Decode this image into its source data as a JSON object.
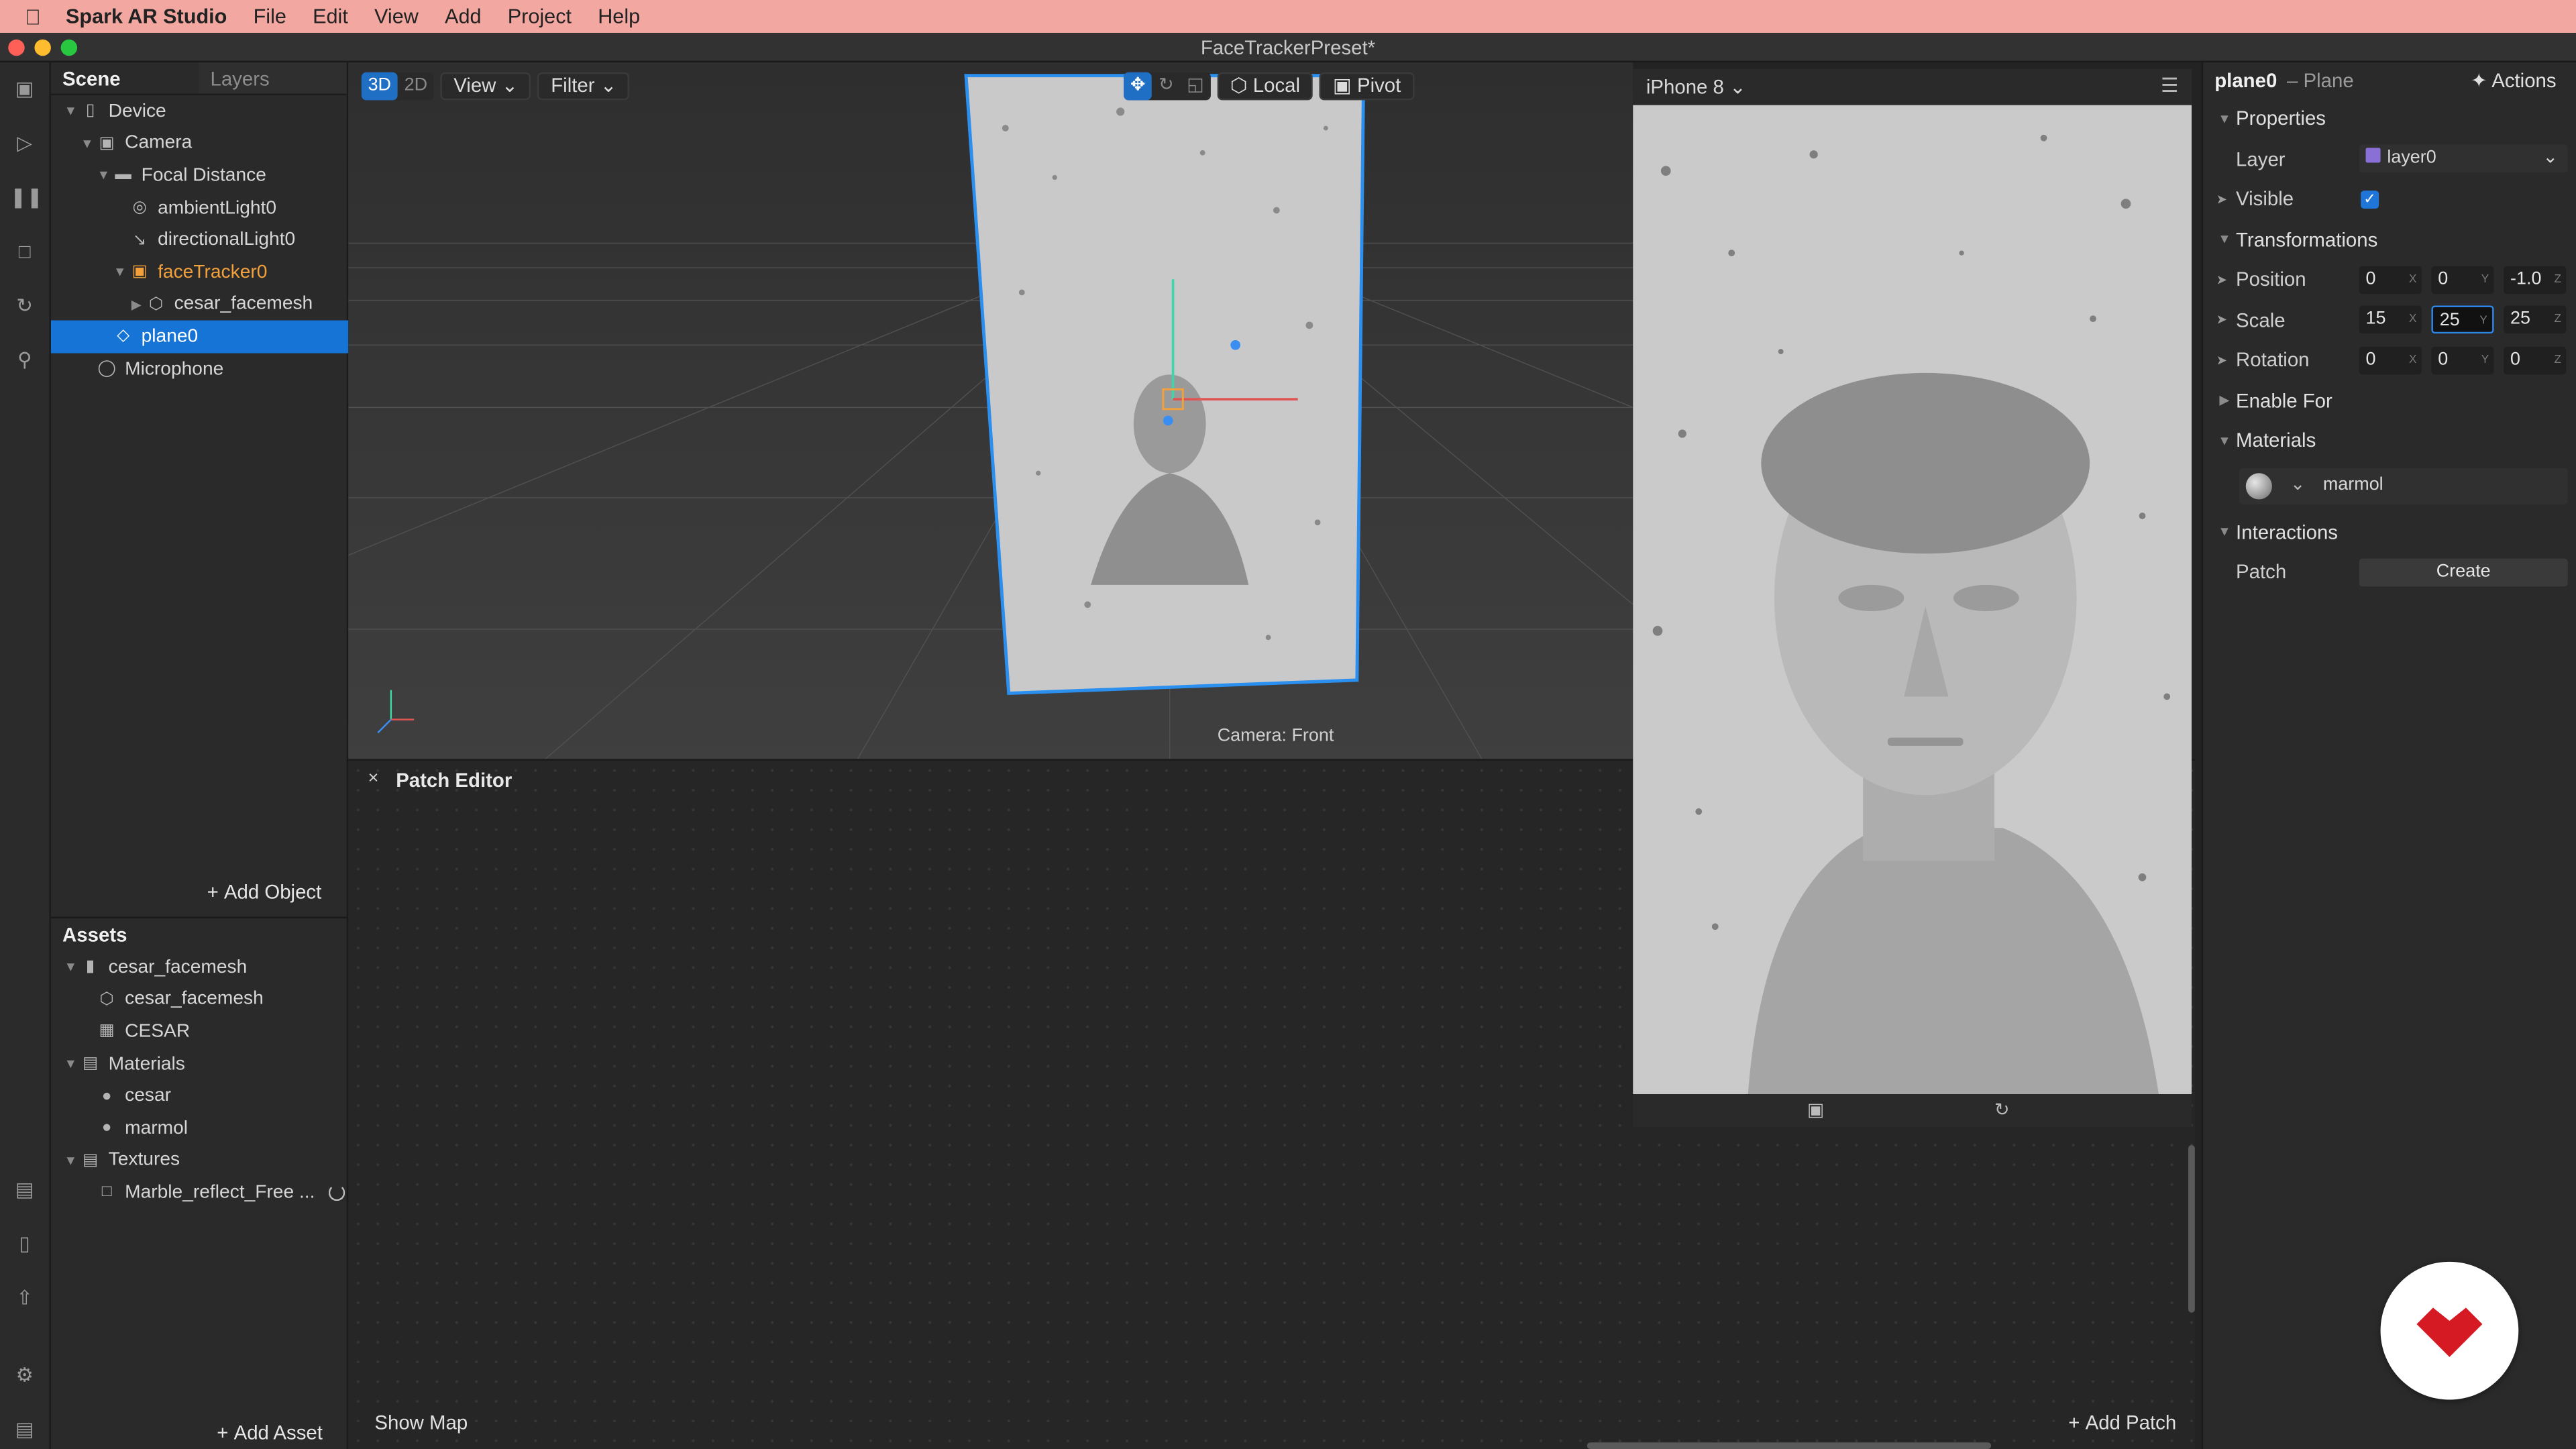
{
  "menubar": {
    "app_name": "Spark AR Studio",
    "items": [
      "File",
      "Edit",
      "View",
      "Add",
      "Project",
      "Help"
    ]
  },
  "window": {
    "title": "FaceTrackerPreset*"
  },
  "scene_panel": {
    "tabs": [
      "Scene",
      "Layers"
    ],
    "tree": [
      {
        "label": "Device"
      },
      {
        "label": "Camera"
      },
      {
        "label": "Focal Distance"
      },
      {
        "label": "ambientLight0"
      },
      {
        "label": "directionalLight0"
      },
      {
        "label": "faceTracker0"
      },
      {
        "label": "cesar_facemesh"
      },
      {
        "label": "plane0"
      },
      {
        "label": "Microphone"
      }
    ],
    "add_object_label": "Add Object"
  },
  "assets_panel": {
    "title": "Assets",
    "tree": [
      {
        "label": "cesar_facemesh"
      },
      {
        "label": "cesar_facemesh"
      },
      {
        "label": "CESAR"
      },
      {
        "label": "Materials"
      },
      {
        "label": "cesar"
      },
      {
        "label": "marmol"
      },
      {
        "label": "Textures"
      },
      {
        "label": "Marble_reflect_Free ..."
      }
    ],
    "add_asset_label": "Add Asset"
  },
  "viewport": {
    "mode_3d": "3D",
    "mode_2d": "2D",
    "view_label": "View",
    "filter_label": "Filter",
    "local_label": "Local",
    "pivot_label": "Pivot",
    "camera_label": "Camera: Front"
  },
  "patch_editor": {
    "title": "Patch Editor",
    "close_glyph": "×",
    "show_map_label": "Show Map",
    "add_patch_label": "Add Patch"
  },
  "simulator": {
    "device": "iPhone 8"
  },
  "properties": {
    "object_name": "plane0",
    "object_type": "– Plane",
    "actions_label": "Actions",
    "sections": {
      "properties": "Properties",
      "transformations": "Transformations",
      "enable_for": "Enable For",
      "materials": "Materials",
      "interactions": "Interactions"
    },
    "layer": {
      "label": "Layer",
      "value": "layer0",
      "color": "#8a6fd6"
    },
    "visible": {
      "label": "Visible",
      "checked": true
    },
    "position": {
      "label": "Position",
      "x": "0",
      "y": "0",
      "z": "-1.0"
    },
    "scale": {
      "label": "Scale",
      "x": "15",
      "y": "25",
      "z": "25"
    },
    "rotation": {
      "label": "Rotation",
      "x": "0",
      "y": "0",
      "z": "0"
    },
    "axis": {
      "x": "X",
      "y": "Y",
      "z": "Z"
    },
    "material": {
      "name": "marmol"
    },
    "patch": {
      "label": "Patch",
      "button": "Create"
    }
  },
  "colors": {
    "menubar_bg": "#f2a8a1",
    "selection": "#1574d6",
    "accent_orange": "#f2a13c",
    "badge_red": "#d61a24"
  }
}
